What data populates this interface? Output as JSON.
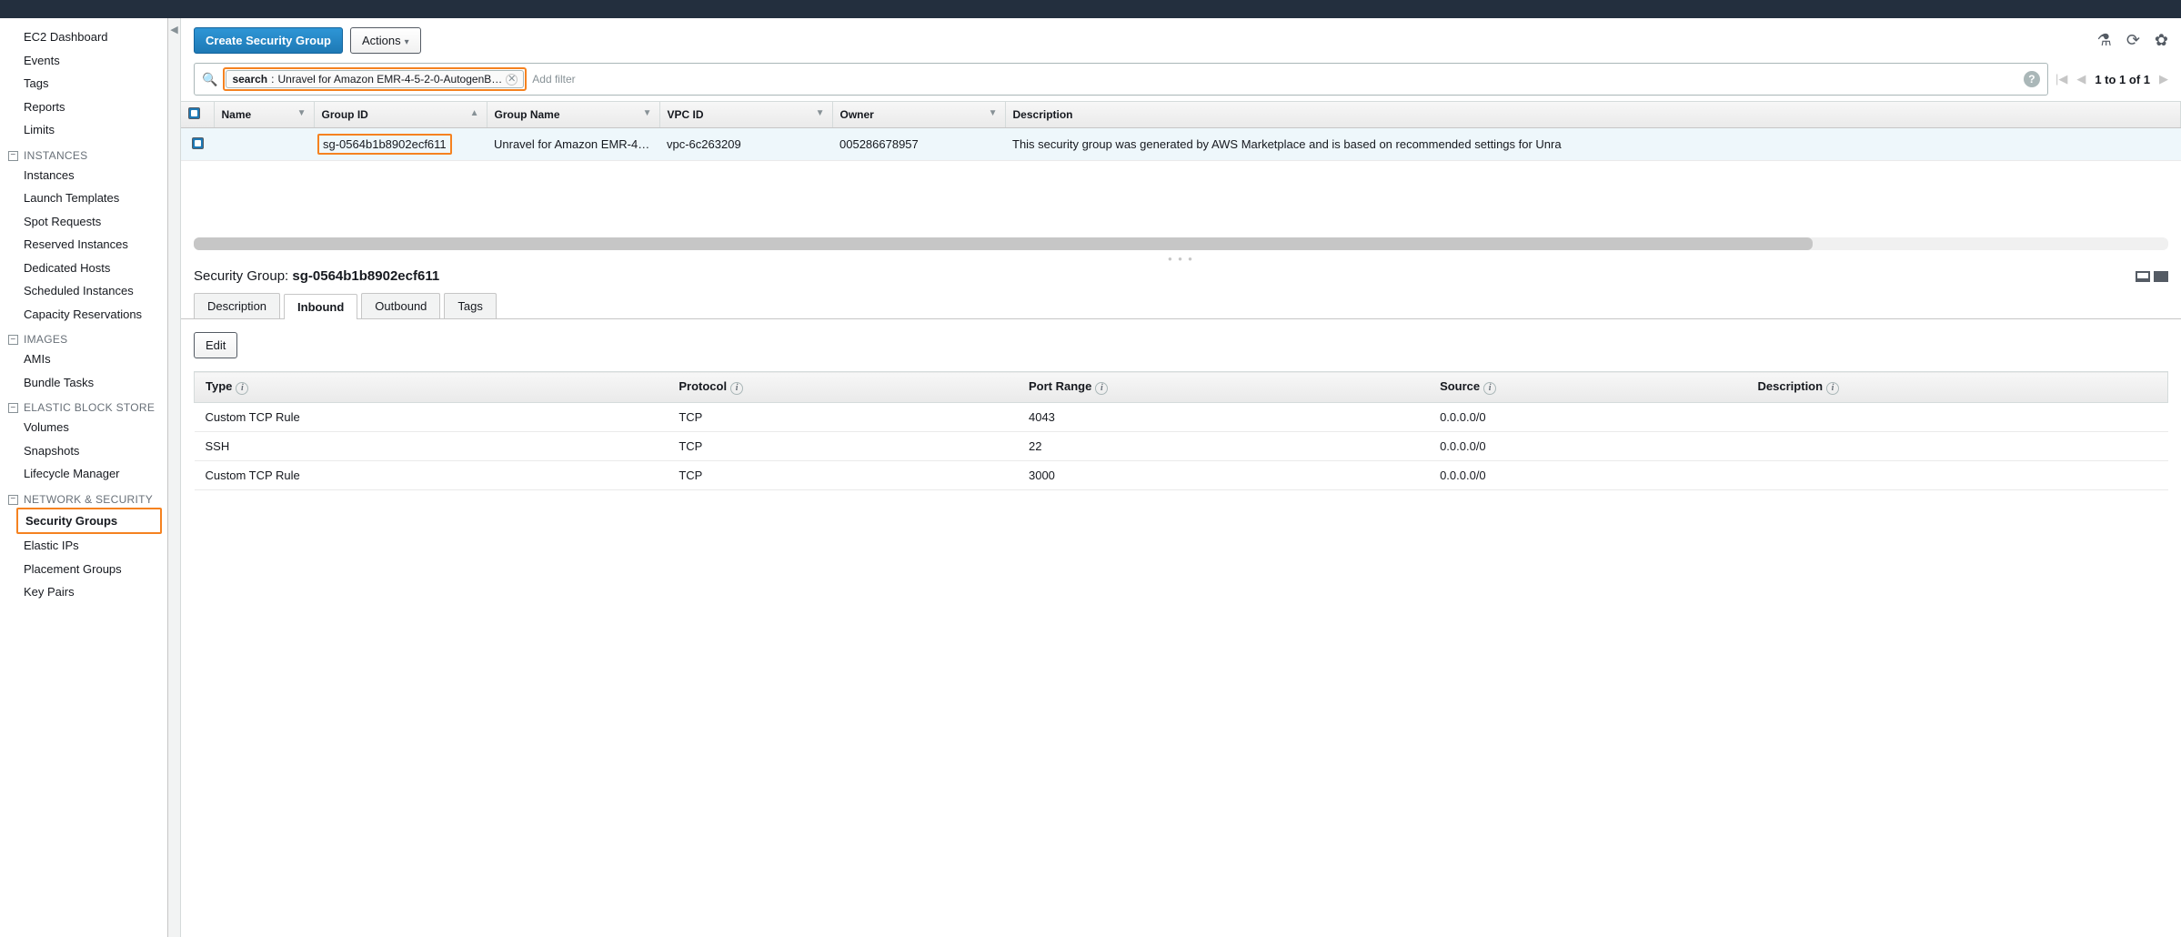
{
  "sidebar": {
    "top": [
      "EC2 Dashboard",
      "Events",
      "Tags",
      "Reports",
      "Limits"
    ],
    "sections": [
      {
        "title": "INSTANCES",
        "items": [
          "Instances",
          "Launch Templates",
          "Spot Requests",
          "Reserved Instances",
          "Dedicated Hosts",
          "Scheduled Instances",
          "Capacity Reservations"
        ]
      },
      {
        "title": "IMAGES",
        "items": [
          "AMIs",
          "Bundle Tasks"
        ]
      },
      {
        "title": "ELASTIC BLOCK STORE",
        "items": [
          "Volumes",
          "Snapshots",
          "Lifecycle Manager"
        ]
      },
      {
        "title": "NETWORK & SECURITY",
        "items": [
          "Security Groups",
          "Elastic IPs",
          "Placement Groups",
          "Key Pairs"
        ],
        "selected": "Security Groups"
      }
    ]
  },
  "toolbar": {
    "create": "Create Security Group",
    "actions": "Actions"
  },
  "search": {
    "label": "search",
    "value": "Unravel for Amazon EMR-4-5-2-0-AutogenB…",
    "placeholder": "Add filter"
  },
  "pager": {
    "text": "1 to 1 of 1"
  },
  "columns": [
    "Name",
    "Group ID",
    "Group Name",
    "VPC ID",
    "Owner",
    "Description"
  ],
  "row": {
    "name": "",
    "group_id": "sg-0564b1b8902ecf611",
    "group_name": "Unravel for Amazon EMR-4…",
    "vpc_id": "vpc-6c263209",
    "owner": "005286678957",
    "description": "This security group was generated by AWS Marketplace and is based on recommended settings for Unra"
  },
  "detail": {
    "label": "Security Group:",
    "id": "sg-0564b1b8902ecf611",
    "tabs": [
      "Description",
      "Inbound",
      "Outbound",
      "Tags"
    ],
    "active": "Inbound",
    "edit": "Edit",
    "rule_columns": [
      "Type",
      "Protocol",
      "Port Range",
      "Source",
      "Description"
    ],
    "rules": [
      {
        "type": "Custom TCP Rule",
        "protocol": "TCP",
        "port": "4043",
        "source": "0.0.0.0/0",
        "desc": ""
      },
      {
        "type": "SSH",
        "protocol": "TCP",
        "port": "22",
        "source": "0.0.0.0/0",
        "desc": ""
      },
      {
        "type": "Custom TCP Rule",
        "protocol": "TCP",
        "port": "3000",
        "source": "0.0.0.0/0",
        "desc": ""
      }
    ]
  }
}
